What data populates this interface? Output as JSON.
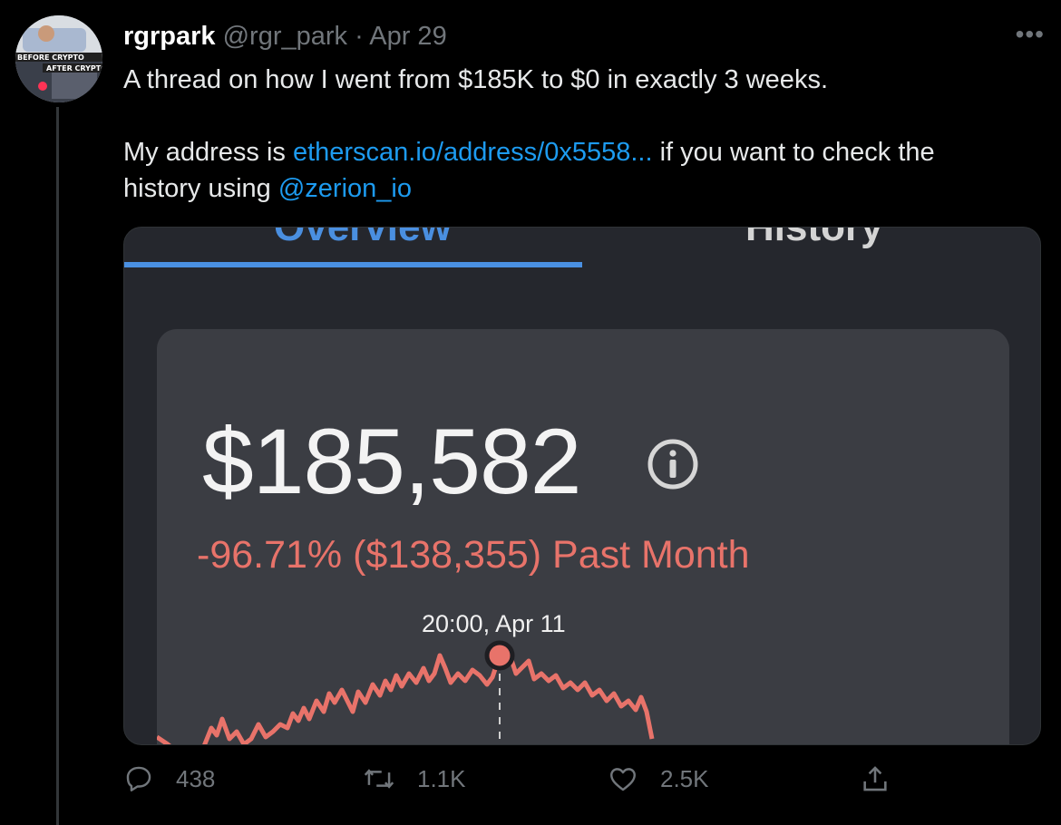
{
  "tweet": {
    "display_name": "rgrpark",
    "handle": "@rgr_park",
    "separator": "·",
    "date": "Apr 29",
    "more_label": "•••",
    "line1": "A thread on how I went from $185K to $0 in exactly 3 weeks.",
    "line2_prefix": "My address is ",
    "line2_link": "etherscan.io/address/0x5558...",
    "line2_suffix": " if you want to check the",
    "line3_prefix": "history using ",
    "line3_mention": "@zerion_io"
  },
  "avatar": {
    "top_text": "BEFORE CRYPTO",
    "bottom_text": "AFTER CRYPTO"
  },
  "media": {
    "tab_overview": "Overview",
    "tab_history": "History",
    "balance": "$185,582",
    "change": "-96.71% ($138,355) Past Month",
    "tooltip_time": "20:00, Apr 11",
    "accent_color": "#4a90e2",
    "negative_color": "#e8736a"
  },
  "actions": {
    "replies": "438",
    "retweets": "1.1K",
    "likes": "2.5K",
    "icons": [
      "reply-icon",
      "retweet-icon",
      "like-icon",
      "share-icon"
    ]
  }
}
